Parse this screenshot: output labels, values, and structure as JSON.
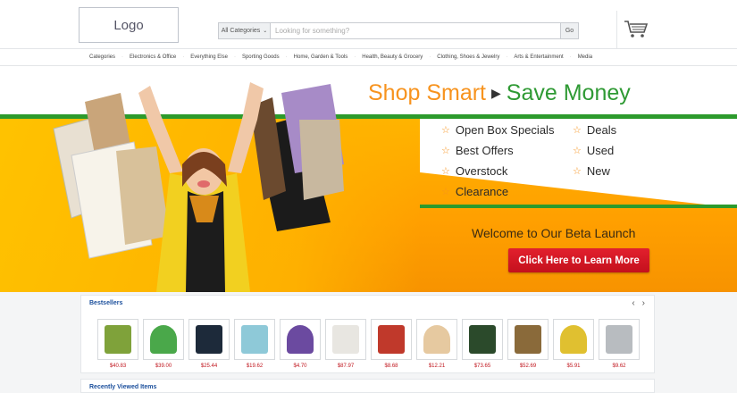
{
  "header": {
    "logo_text": "Logo",
    "search": {
      "category": "All Categories",
      "placeholder": "Looking for something?",
      "go_label": "Go"
    },
    "cart_icon": "shopping-cart-icon"
  },
  "nav": {
    "items": [
      "Categories",
      "Electronics & Office",
      "Everything Else",
      "Sporting Goods",
      "Home, Garden & Tools",
      "Health, Beauty & Grocery",
      "Clothing, Shoes & Jewelry",
      "Arts & Entertainment",
      "Media"
    ]
  },
  "banner": {
    "title_left": "Shop Smart",
    "title_right": "Save Money",
    "features_left": [
      "Open Box Specials",
      "Best Offers",
      "Overstock",
      "Clearance"
    ],
    "features_right": [
      "Deals",
      "Used",
      "New"
    ],
    "welcome": "Welcome to Our Beta Launch",
    "cta_label": "Click Here to Learn More",
    "colors": {
      "orange": "#f7931e",
      "green": "#2f9a34",
      "cta": "#d4171f"
    }
  },
  "bestsellers": {
    "title": "Bestsellers",
    "products": [
      {
        "price": "$40.83",
        "icon": "aquarium-kit-icon"
      },
      {
        "price": "$39.00",
        "icon": "green-box-product-icon"
      },
      {
        "price": "$25.44",
        "icon": "dark-canister-icon"
      },
      {
        "price": "$19.62",
        "icon": "plant-pack-icon"
      },
      {
        "price": "$4.70",
        "icon": "toy-figure-icon"
      },
      {
        "price": "$87.97",
        "icon": "white-cabinet-icon"
      },
      {
        "price": "$8.68",
        "icon": "clamps-icon"
      },
      {
        "price": "$12.21",
        "icon": "bottle-icon"
      },
      {
        "price": "$73.65",
        "icon": "circuit-board-icon"
      },
      {
        "price": "$52.69",
        "icon": "food-bag-icon"
      },
      {
        "price": "$5.91",
        "icon": "fish-food-can-icon"
      },
      {
        "price": "$9.62",
        "icon": "silver-pouch-icon"
      }
    ]
  },
  "recent": {
    "title": "Recently Viewed Items"
  }
}
